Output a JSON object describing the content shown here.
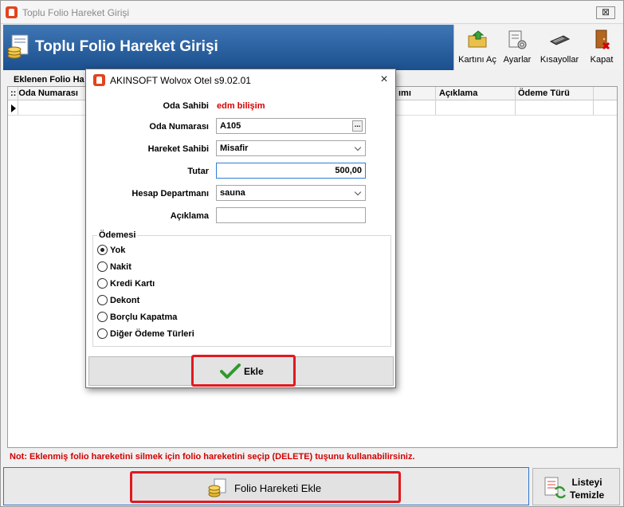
{
  "window": {
    "title": "Toplu Folio Hareket Girişi",
    "close_label": "⊠",
    "header_title": "Toplu Folio Hareket Girişi"
  },
  "toolbar": {
    "items": [
      {
        "label": "Kartını Aç",
        "icon": "folder-open-icon"
      },
      {
        "label": "Ayarlar",
        "icon": "settings-icon"
      },
      {
        "label": "Kısayollar",
        "icon": "keyboard-icon"
      },
      {
        "label": "Kapat",
        "icon": "exit-door-icon"
      }
    ]
  },
  "list": {
    "label": "Eklenen Folio Ha",
    "columns": [
      ":: Oda Numarası",
      "ımı",
      "Açıklama",
      "Ödeme Türü"
    ]
  },
  "note": "Not: Eklenmiş folio hareketini silmek için folio hareketini seçip (DELETE) tuşunu kullanabilirsiniz.",
  "bottom": {
    "add_button": "Folio Hareketi Ekle",
    "clear_button_line1": "Listeyi",
    "clear_button_line2": "Temizle"
  },
  "dialog": {
    "title": "AKINSOFT Wolvox Otel s9.02.01",
    "close_label": "×",
    "fields": {
      "owner_label": "Oda Sahibi",
      "owner_value": "edm bilişim",
      "room_label": "Oda Numarası",
      "room_value": "A105",
      "room_button": "...",
      "mover_label": "Hareket Sahibi",
      "mover_value": "Misafir",
      "amount_label": "Tutar",
      "amount_value": "500,00",
      "dept_label": "Hesap Departmanı",
      "dept_value": "sauna",
      "desc_label": "Açıklama",
      "desc_value": ""
    },
    "payment": {
      "legend": "Ödemesi",
      "selected": "Yok",
      "options": [
        "Yok",
        "Nakit",
        "Kredi Kartı",
        "Dekont",
        "Borçlu Kapatma",
        "Diğer Ödeme Türleri"
      ]
    },
    "add_button": "Ekle"
  },
  "colors": {
    "header_blue": "#1b4f8e",
    "alert_red": "#d40000",
    "highlight_red": "#e0191f",
    "focus_blue": "#2f7fd4"
  }
}
